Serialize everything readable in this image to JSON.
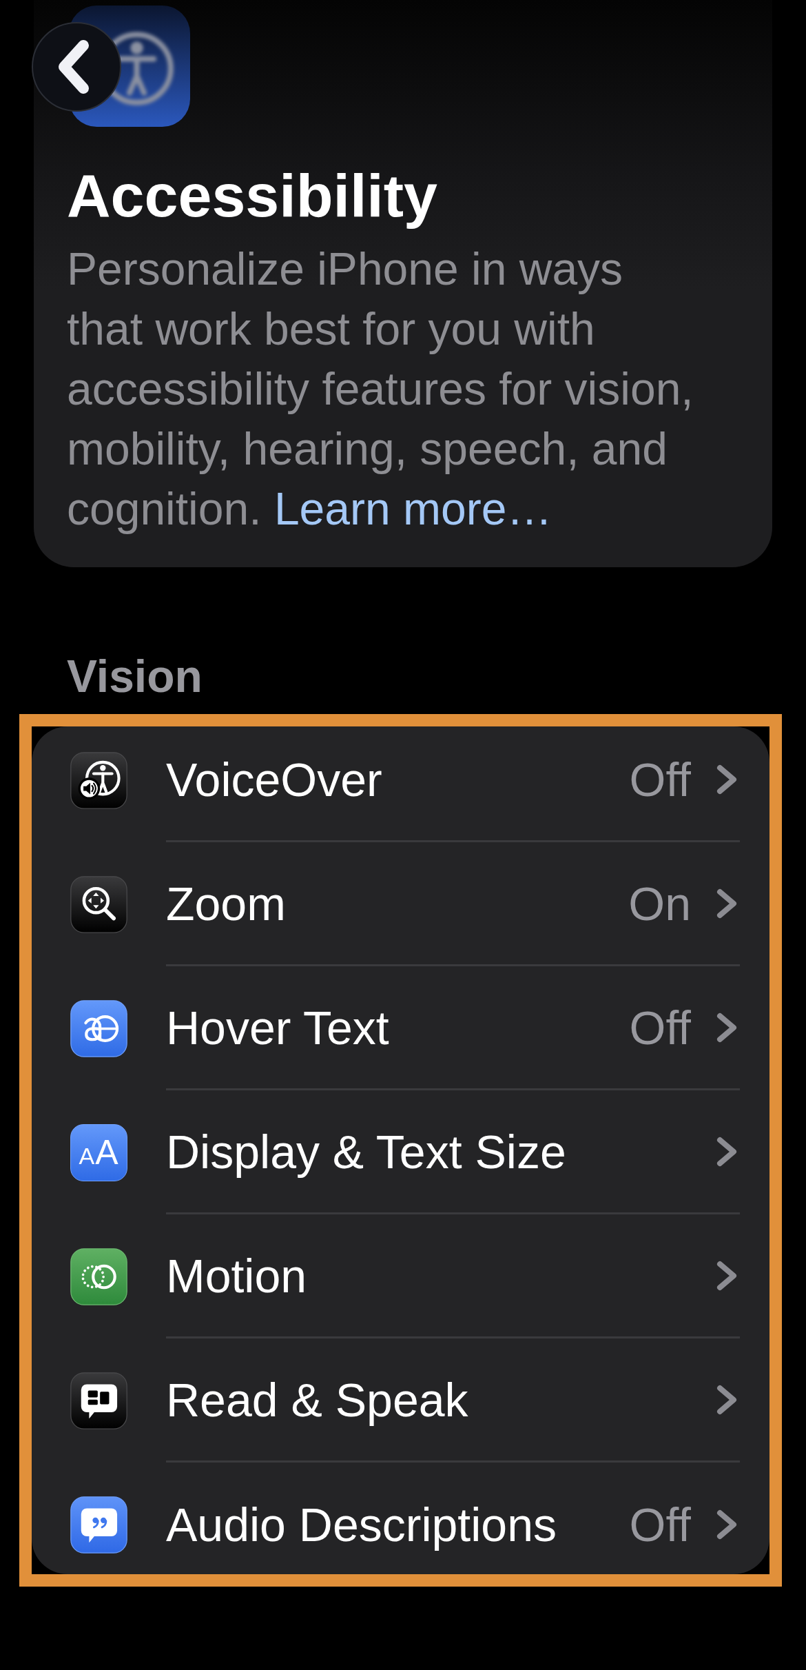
{
  "header": {
    "title": "Accessibility",
    "description": "Personalize iPhone in ways that work best for you with accessibility features for vision, mobility, hearing, speech, and cognition.",
    "link": "Learn more…"
  },
  "section": {
    "title": "Vision",
    "highlighted": true,
    "rows": [
      {
        "label": "VoiceOver",
        "value": "Off"
      },
      {
        "label": "Zoom",
        "value": "On"
      },
      {
        "label": "Hover Text",
        "value": "Off"
      },
      {
        "label": "Display & Text Size",
        "icon_glyph": "AA"
      },
      {
        "label": "Motion"
      },
      {
        "label": "Read & Speak"
      },
      {
        "label": "Audio Descriptions",
        "value": "Off"
      }
    ]
  }
}
